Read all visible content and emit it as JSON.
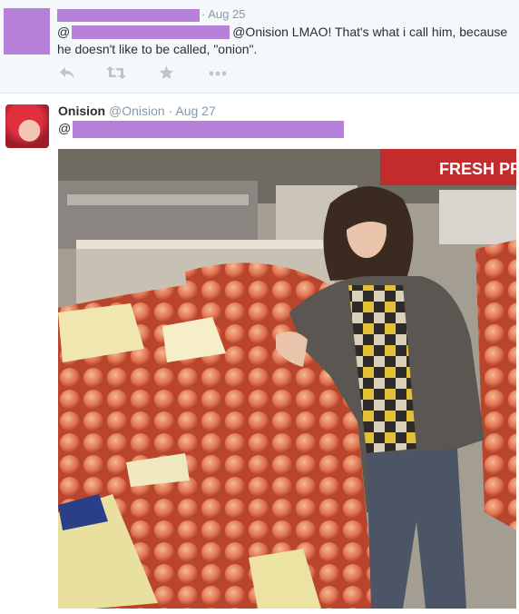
{
  "reply_tweet": {
    "date": "· Aug 25",
    "text_prefix": "@",
    "text_mention": "@Onision",
    "text_body": " LMAO! That's what i call him, because he doesn't like to be called, \"onion\".",
    "actions": [
      {
        "icon": "reply-icon"
      },
      {
        "icon": "retweet-icon"
      },
      {
        "icon": "favorite-star-icon"
      },
      {
        "icon": "more-dots-icon"
      }
    ]
  },
  "photo_tweet": {
    "fullname": "Onision",
    "handle": "@Onision",
    "date": "· Aug 27",
    "text_prefix": "@",
    "photo_sign": "FRESH PRODUC"
  },
  "colors": {
    "redaction": "#b681d8",
    "muted_text": "#8899a6",
    "body_text": "#292f33",
    "reply_background": "#f5f8fa"
  }
}
